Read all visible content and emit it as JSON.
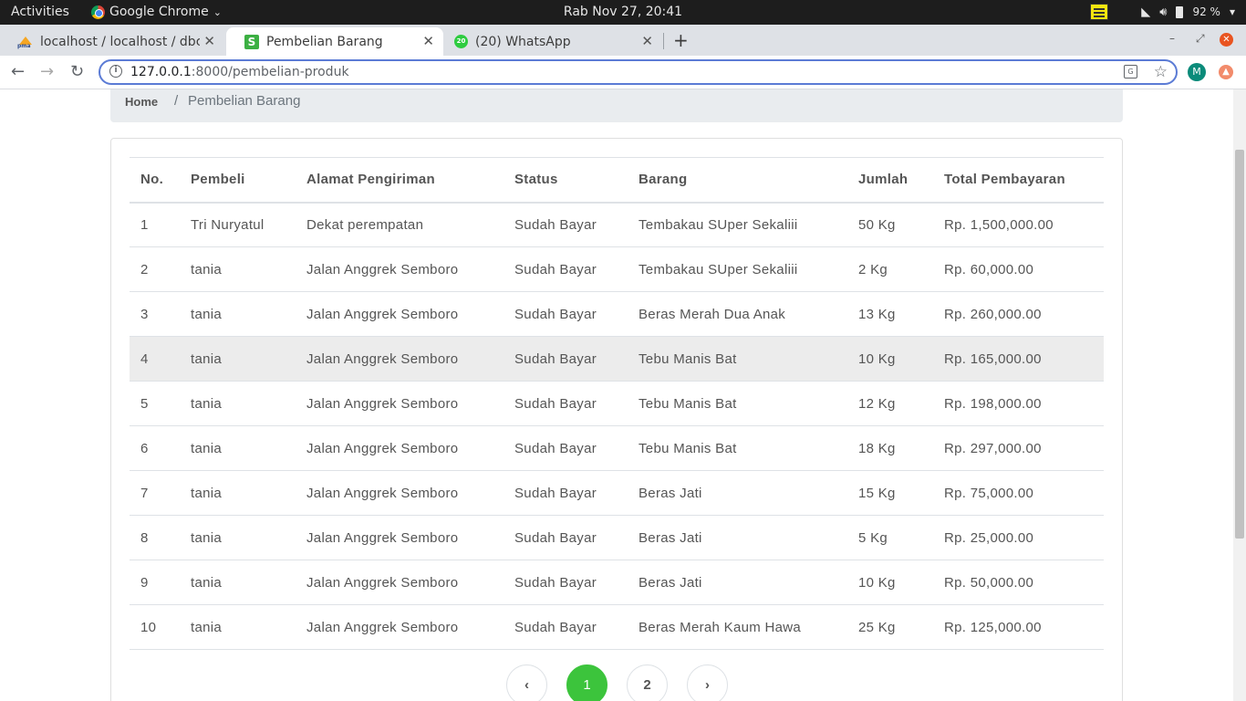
{
  "system_bar": {
    "activities": "Activities",
    "app_name": "Google Chrome",
    "app_caret": "⌄",
    "clock": "Rab Nov 27, 20:41",
    "battery": "92 %"
  },
  "tabs": [
    {
      "title": "localhost / localhost / dbc",
      "favicon": "phpmyadmin-icon",
      "active": false
    },
    {
      "title": "Pembelian Barang",
      "favicon": "s-icon",
      "active": true
    },
    {
      "title": "(20) WhatsApp",
      "favicon": "whatsapp-icon",
      "badge": "20",
      "active": false
    }
  ],
  "toolbar": {
    "url_host": "127.0.0.1",
    "url_rest": ":8000/pembelian-produk",
    "avatar_letter": "M"
  },
  "breadcrumb": {
    "home": "Home",
    "separator": "/",
    "current": "Pembelian Barang"
  },
  "table": {
    "headers": [
      "No.",
      "Pembeli",
      "Alamat Pengiriman",
      "Status",
      "Barang",
      "Jumlah",
      "Total Pembayaran"
    ],
    "rows": [
      [
        "1",
        "Tri Nuryatul",
        "Dekat perempatan",
        "Sudah Bayar",
        "Tembakau SUper Sekaliii",
        "50 Kg",
        "Rp. 1,500,000.00"
      ],
      [
        "2",
        "tania",
        "Jalan Anggrek Semboro",
        "Sudah Bayar",
        "Tembakau SUper Sekaliii",
        "2 Kg",
        "Rp. 60,000.00"
      ],
      [
        "3",
        "tania",
        "Jalan Anggrek Semboro",
        "Sudah Bayar",
        "Beras Merah Dua Anak",
        "13 Kg",
        "Rp. 260,000.00"
      ],
      [
        "4",
        "tania",
        "Jalan Anggrek Semboro",
        "Sudah Bayar",
        "Tebu Manis Bat",
        "10 Kg",
        "Rp. 165,000.00"
      ],
      [
        "5",
        "tania",
        "Jalan Anggrek Semboro",
        "Sudah Bayar",
        "Tebu Manis Bat",
        "12 Kg",
        "Rp. 198,000.00"
      ],
      [
        "6",
        "tania",
        "Jalan Anggrek Semboro",
        "Sudah Bayar",
        "Tebu Manis Bat",
        "18 Kg",
        "Rp. 297,000.00"
      ],
      [
        "7",
        "tania",
        "Jalan Anggrek Semboro",
        "Sudah Bayar",
        "Beras Jati",
        "15 Kg",
        "Rp. 75,000.00"
      ],
      [
        "8",
        "tania",
        "Jalan Anggrek Semboro",
        "Sudah Bayar",
        "Beras Jati",
        "5 Kg",
        "Rp. 25,000.00"
      ],
      [
        "9",
        "tania",
        "Jalan Anggrek Semboro",
        "Sudah Bayar",
        "Beras Jati",
        "10 Kg",
        "Rp. 50,000.00"
      ],
      [
        "10",
        "tania",
        "Jalan Anggrek Semboro",
        "Sudah Bayar",
        "Beras Merah Kaum Hawa",
        "25 Kg",
        "Rp. 125,000.00"
      ]
    ],
    "hovered_row": 3
  },
  "pagination": {
    "prev": "‹",
    "pages": [
      "1",
      "2"
    ],
    "active_page": "1",
    "next": "›"
  },
  "colors": {
    "accent": "#3cc43c",
    "omnibox_border": "#5b7bd5"
  }
}
